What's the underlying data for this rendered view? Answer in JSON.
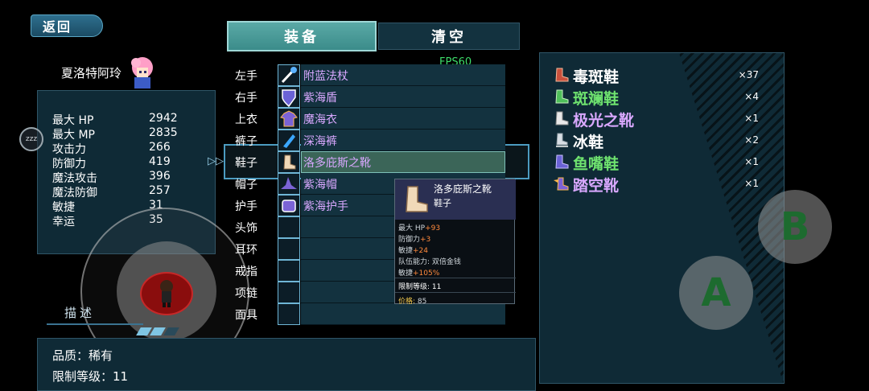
{
  "back_label": "返回",
  "character": {
    "name": "夏洛特阿玲"
  },
  "stats": [
    {
      "label": "最大 HP",
      "value": "2942"
    },
    {
      "label": "最大 MP",
      "value": "2835"
    },
    {
      "label": "攻击力",
      "value": "266"
    },
    {
      "label": "防御力",
      "value": "419"
    },
    {
      "label": "魔法攻击",
      "value": "396"
    },
    {
      "label": "魔法防御",
      "value": "257"
    },
    {
      "label": "敏捷",
      "value": "31"
    },
    {
      "label": "幸运",
      "value": "35"
    }
  ],
  "zzz_label": "zzz",
  "tabs": {
    "equip": "装备",
    "clear": "清空"
  },
  "fps": "FPS60",
  "slots": [
    {
      "label": "左手",
      "item": "附蓝法杖",
      "icon": "staff-icon"
    },
    {
      "label": "右手",
      "item": "紫海盾",
      "icon": "shield-icon"
    },
    {
      "label": "上衣",
      "item": "魔海衣",
      "icon": "robe-icon"
    },
    {
      "label": "裤子",
      "item": "深海裤",
      "icon": "pants-icon"
    },
    {
      "label": "鞋子",
      "item": "洛多庇斯之靴",
      "icon": "boots-icon"
    },
    {
      "label": "帽子",
      "item": "紫海帽",
      "icon": "hat-icon"
    },
    {
      "label": "护手",
      "item": "紫海护手",
      "icon": "gauntlet-icon"
    },
    {
      "label": "头饰",
      "item": "",
      "icon": ""
    },
    {
      "label": "耳环",
      "item": "",
      "icon": ""
    },
    {
      "label": "戒指",
      "item": "",
      "icon": ""
    },
    {
      "label": "项链",
      "item": "",
      "icon": ""
    },
    {
      "label": "面具",
      "item": "",
      "icon": ""
    }
  ],
  "tooltip": {
    "title": "洛多庇斯之靴",
    "type": "鞋子",
    "lines": [
      {
        "label": "最大 HP",
        "bonus": "+93"
      },
      {
        "label": "防御力",
        "bonus": "+3"
      },
      {
        "label": "敏捷",
        "bonus": "+24"
      },
      {
        "label": "队伍能力: 双倍金钱",
        "bonus": ""
      },
      {
        "label": "敏捷",
        "bonus": "+105%"
      }
    ],
    "requirement": "限制等级: 11",
    "price_label": "价格:",
    "price_value": "85"
  },
  "inventory": [
    {
      "name": "毒斑鞋",
      "qty": "×37",
      "color": "#ffffff",
      "icon": "boots-red-icon"
    },
    {
      "name": "斑斓鞋",
      "qty": "×4",
      "color": "#6fe36f",
      "icon": "boots-green-icon"
    },
    {
      "name": "极光之靴",
      "qty": "×1",
      "color": "#d9a8ff",
      "icon": "boots-white-icon"
    },
    {
      "name": "冰鞋",
      "qty": "×2",
      "color": "#ffffff",
      "icon": "skates-icon"
    },
    {
      "name": "鱼嘴鞋",
      "qty": "×1",
      "color": "#6fe36f",
      "icon": "boots-purple-icon"
    },
    {
      "name": "踏空靴",
      "qty": "×1",
      "color": "#d9a8ff",
      "icon": "winged-boots-icon"
    }
  ],
  "description": {
    "tab": "描述",
    "quality": "品质：稀有",
    "level": "限制等级：11"
  },
  "buttons": {
    "a": "A",
    "b": "B"
  }
}
